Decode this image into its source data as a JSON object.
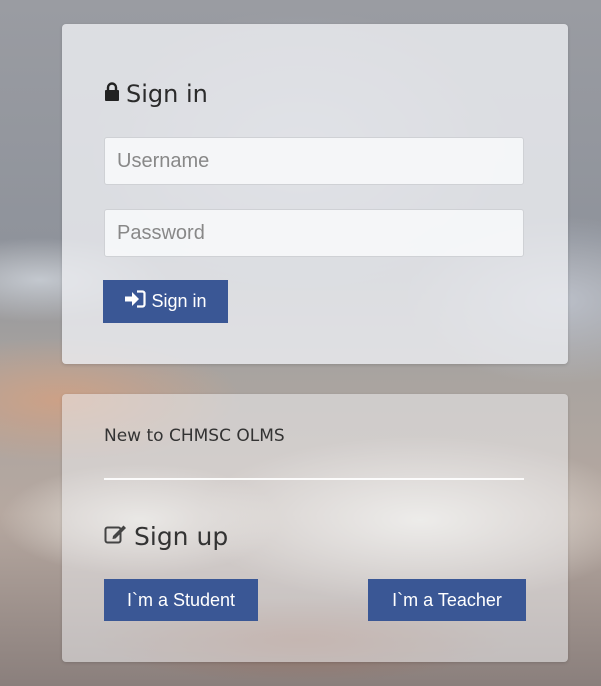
{
  "signin_panel": {
    "title": "Sign in",
    "title_icon": "lock-icon",
    "username": {
      "placeholder": "Username",
      "value": ""
    },
    "password": {
      "placeholder": "Password",
      "value": ""
    },
    "submit_label": "Sign in",
    "submit_icon": "sign-in-arrow-icon"
  },
  "signup_panel": {
    "intro_text": "New to CHMSC OLMS",
    "title": "Sign up",
    "title_icon": "edit-icon",
    "student_button_label": "I`m a Student",
    "teacher_button_label": "I`m a Teacher"
  },
  "colors": {
    "button": "#3a5795",
    "button_text": "#ffffff",
    "panel": "#ecedf0"
  }
}
